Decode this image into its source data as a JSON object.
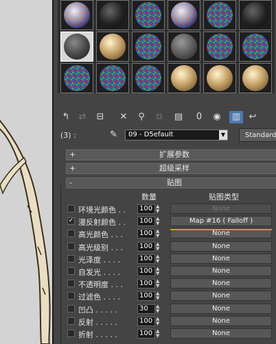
{
  "material_slots": [
    {
      "kind": "checker-glass"
    },
    {
      "kind": "dark"
    },
    {
      "kind": "checker"
    },
    {
      "kind": "checker-glass"
    },
    {
      "kind": "checker"
    },
    {
      "kind": "dark"
    },
    {
      "kind": "grey-sel"
    },
    {
      "kind": "wood"
    },
    {
      "kind": "checker"
    },
    {
      "kind": "grey"
    },
    {
      "kind": "checker"
    },
    {
      "kind": "checker"
    },
    {
      "kind": "checker"
    },
    {
      "kind": "checker"
    },
    {
      "kind": "checker"
    },
    {
      "kind": "wood"
    },
    {
      "kind": "wood"
    },
    {
      "kind": "wood"
    }
  ],
  "toolbar": {
    "zero_label": "0"
  },
  "material": {
    "slot_label": "(3) :",
    "name": "09 - D5efault",
    "type_button": "Standard"
  },
  "rollouts": {
    "extended_params": {
      "sign": "+",
      "title": "扩展参数"
    },
    "supersampling": {
      "sign": "+",
      "title": "超级采样"
    },
    "maps": {
      "sign": "-",
      "title": "贴图"
    }
  },
  "maps_table": {
    "header_amount": "数量",
    "header_maptype": "贴图类型",
    "rows": [
      {
        "name": "环境光颜色 . .",
        "checked": false,
        "amount": "100",
        "map": "None",
        "disabled": true
      },
      {
        "name": "漫反射颜色 . .",
        "checked": true,
        "amount": "100",
        "map": "Map #16   ( Falloff )",
        "disabled": false
      },
      {
        "name": "高光颜色 . . .",
        "checked": false,
        "amount": "100",
        "map": "None",
        "disabled": false
      },
      {
        "name": "高光级别 . . .",
        "checked": false,
        "amount": "100",
        "map": "None",
        "disabled": false
      },
      {
        "name": "光泽度 . . . .",
        "checked": false,
        "amount": "100",
        "map": "None",
        "disabled": false
      },
      {
        "name": "自发光 . . . .",
        "checked": false,
        "amount": "100",
        "map": "None",
        "disabled": false
      },
      {
        "name": "不透明度 . . .",
        "checked": false,
        "amount": "100",
        "map": "None",
        "disabled": false
      },
      {
        "name": "过滤色 . . . .",
        "checked": false,
        "amount": "100",
        "map": "None",
        "disabled": false
      },
      {
        "name": "凹凸 . . . . .",
        "checked": false,
        "amount": "30",
        "map": "None",
        "disabled": false
      },
      {
        "name": "反射 . . . . .",
        "checked": false,
        "amount": "100",
        "map": "None",
        "disabled": false
      },
      {
        "name": "折射 . . . . .",
        "checked": false,
        "amount": "100",
        "map": "None",
        "disabled": false
      }
    ]
  }
}
